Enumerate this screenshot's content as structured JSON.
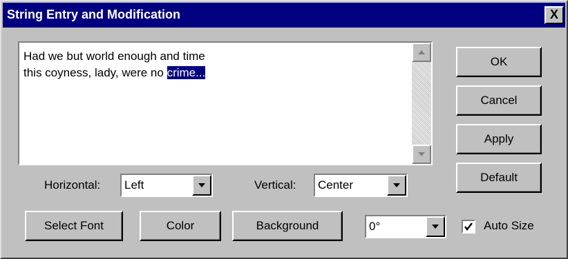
{
  "dialog": {
    "title": "String Entry and Modification",
    "close_label": "X"
  },
  "text_entry": {
    "line1": "Had we but world enough and time",
    "line2_plain": "this coyness, lady, were no ",
    "line2_selected": "crime..."
  },
  "buttons": {
    "ok": "OK",
    "cancel": "Cancel",
    "apply": "Apply",
    "default": "Default",
    "select_font": "Select Font",
    "color": "Color",
    "background": "Background"
  },
  "alignment": {
    "horizontal_label": "Horizontal:",
    "horizontal_value": "Left",
    "vertical_label": "Vertical:",
    "vertical_value": "Center"
  },
  "rotation": {
    "value": "0°"
  },
  "auto_size": {
    "label": "Auto Size",
    "checked": true
  },
  "colors": {
    "titlebar": "#000080",
    "face": "#c0c0c0",
    "selection": "#000080"
  }
}
